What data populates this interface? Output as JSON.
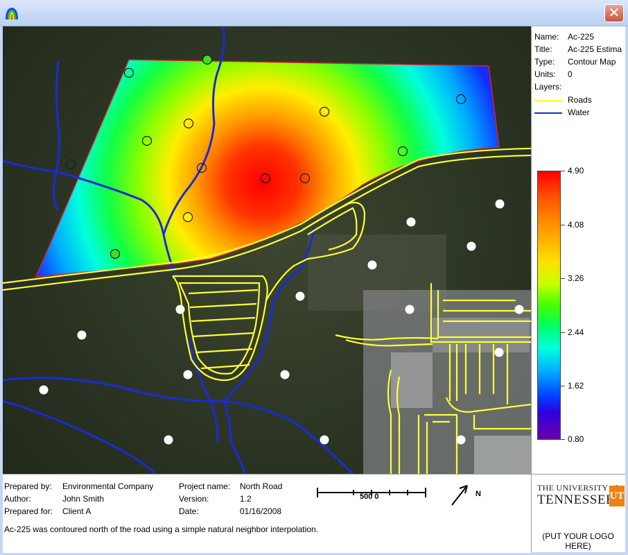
{
  "window": {
    "close_label": "✕"
  },
  "icons": {
    "app": "contour-app-icon",
    "close": "close-icon",
    "north_arrow": "north-arrow-icon"
  },
  "colors": {
    "title_bar": "#c7d8f6",
    "roads": "#ffff33",
    "water": "#1a2bd6",
    "boundary": "#d8202a"
  },
  "info": {
    "name_label": "Name:",
    "name_value": "Ac-225",
    "title_label": "Title:",
    "title_value": "Ac-225 Estima",
    "type_label": "Type:",
    "type_value": "Contour Map",
    "units_label": "Units:",
    "units_value": "0",
    "layers_label": "Layers:",
    "layers": [
      {
        "name": "Roads",
        "color": "#ffff33"
      },
      {
        "name": "Water",
        "color": "#1a2bd6"
      }
    ]
  },
  "colorbar": {
    "labels": [
      "4.90",
      "4.08",
      "3.26",
      "2.44",
      "1.62",
      "0.80"
    ],
    "max": 4.9,
    "min": 0.8
  },
  "footer": {
    "prepared_by_label": "Prepared by:",
    "prepared_by_value": "Environmental Company",
    "author_label": "Author:",
    "author_value": "John Smith",
    "prepared_for_label": "Prepared for:",
    "prepared_for_value": "Client A",
    "project_label": "Project name:",
    "project_value": "North Road",
    "version_label": "Version:",
    "version_value": "1.2",
    "date_label": "Date:",
    "date_value": "01/16/2008",
    "scale_label": "500 0",
    "north_label": "N",
    "note": "Ac-225 was contoured north of the road using a simple natural neighbor interpolation."
  },
  "logo": {
    "line1": "THE UNIVERSITY of",
    "line2": "TENNESSEE",
    "placeholder": "(PUT YOUR LOGO HERE)"
  }
}
